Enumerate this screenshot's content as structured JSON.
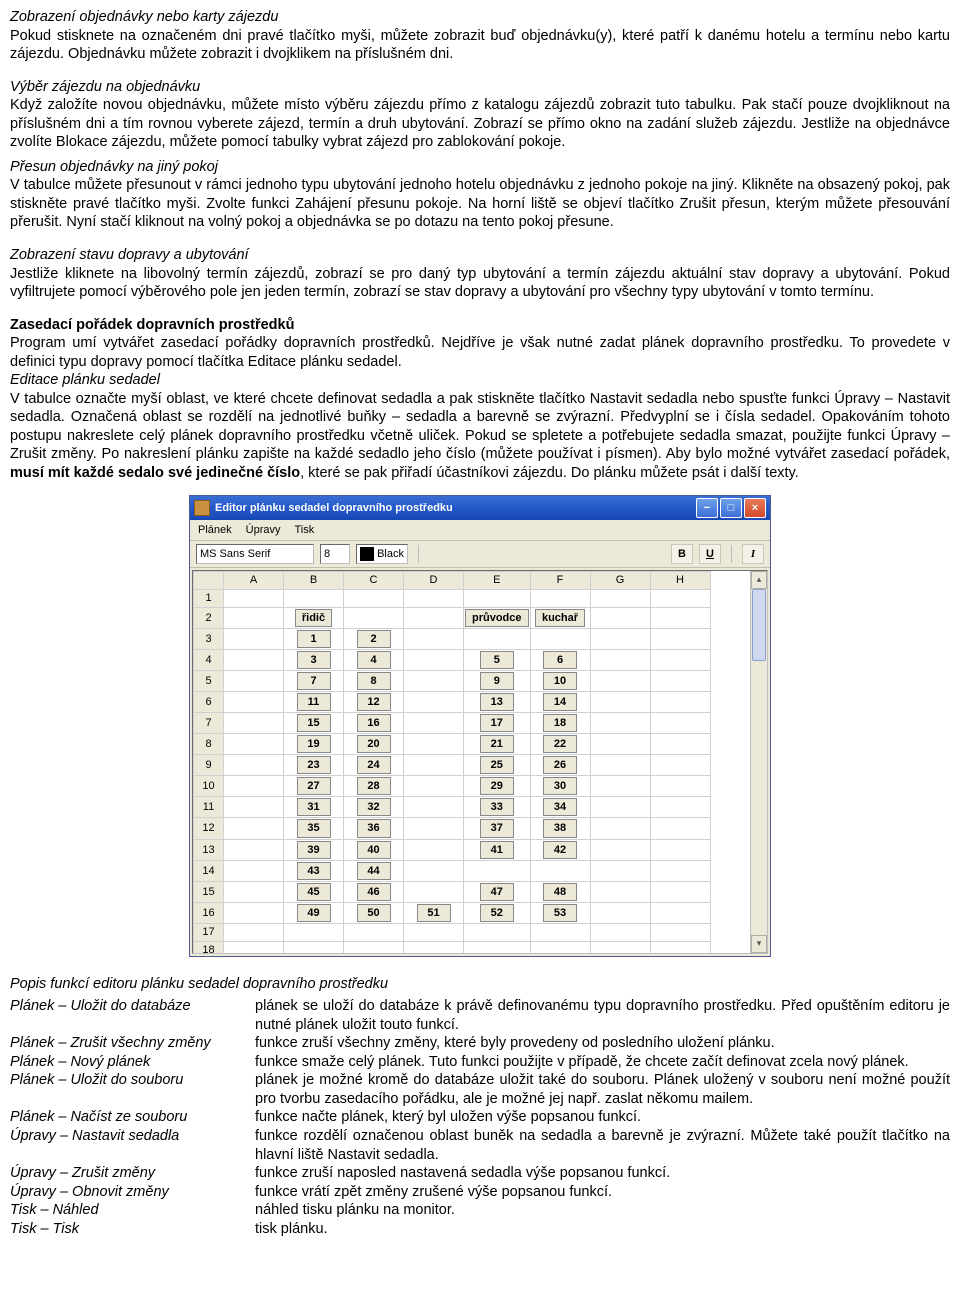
{
  "s1": {
    "h": "Zobrazení objednávky nebo karty zájezdu",
    "p": "Pokud stisknete na označeném dni pravé tlačítko myši, můžete zobrazit buď objednávku(y), které patří k danému hotelu a termínu nebo kartu zájezdu. Objednávku můžete zobrazit i dvojklikem na příslušném dni."
  },
  "s2": {
    "h": "Výběr zájezdu na objednávku",
    "p": "Když založíte novou objednávku, můžete místo výběru zájezdu přímo z katalogu zájezdů zobrazit tuto tabulku. Pak stačí pouze dvojkliknout na příslušném dni a tím rovnou vyberete zájezd, termín a druh ubytování. Zobrazí se přímo okno na zadání služeb zájezdu. Jestliže na objednávce zvolíte Blokace zájezdu, můžete pomocí tabulky vybrat zájezd pro zablokování pokoje."
  },
  "s3": {
    "h": "Přesun objednávky na jiný pokoj",
    "p": "V tabulce můžete přesunout v rámci jednoho typu ubytování jednoho hotelu objednávku z jednoho pokoje na jiný. Klikněte na obsazený pokoj, pak stiskněte pravé tlačítko myši. Zvolte funkci Zahájení přesunu pokoje. Na horní liště se objeví tlačítko Zrušit přesun, kterým můžete přesouvání přerušit. Nyní stačí kliknout na volný pokoj a objednávka se po dotazu na tento pokoj přesune."
  },
  "s4": {
    "h": "Zobrazení stavu dopravy a ubytování",
    "p": "Jestliže kliknete na libovolný termín zájezdů, zobrazí se pro daný typ ubytování a termín zájezdu aktuální stav dopravy a ubytování. Pokud vyfiltrujete pomocí výběrového pole jen jeden termín, zobrazí se stav dopravy a ubytování pro všechny typy ubytování v tomto termínu."
  },
  "s5": {
    "h": "Zasedací pořádek dopravních prostředků",
    "p": "Program umí vytvářet zasedací pořádky dopravních prostředků. Nejdříve je však nutné zadat plánek dopravního prostředku. To provedete v definici typu dopravy pomocí tlačítka Editace plánku sedadel."
  },
  "s6": {
    "h": "Editace plánku sedadel",
    "p1": "V tabulce označte myší oblast, ve které chcete definovat sedadla a pak stiskněte tlačítko Nastavit sedadla nebo spusťte funkci Úpravy – Nastavit sedadla. Označená oblast se rozdělí na jednotlivé buňky – sedadla a barevně se zvýrazní. Předvyplní se i čísla sedadel. Opakováním tohoto postupu nakreslete celý plánek dopravního prostředku včetně uliček. Pokud se spletete a potřebujete sedadla smazat, použijte funkci Úpravy – Zrušit změny. Po nakreslení plánku zapište na každé sedadlo jeho číslo (můžete používat i písmen). Aby bylo možné vytvářet zasedací pořádek, ",
    "p1b": "musí mít každé sedalo své jedinečné číslo",
    "p1c": ", které se pak přiřadí účastníkovi zájezdu. Do plánku můžete psát i další texty."
  },
  "editor": {
    "title": "Editor plánku sedadel dopravního prostředku",
    "menu": {
      "m1": "Plánek",
      "m2": "Úpravy",
      "m3": "Tisk"
    },
    "toolbar": {
      "font": "MS Sans Serif",
      "size": "8",
      "color": "Black",
      "b": "B",
      "u": "U",
      "i": "I"
    },
    "cols": [
      "A",
      "B",
      "C",
      "D",
      "E",
      "F",
      "G",
      "H"
    ],
    "rows": [
      "1",
      "2",
      "3",
      "4",
      "5",
      "6",
      "7",
      "8",
      "9",
      "10",
      "11",
      "12",
      "13",
      "14",
      "15",
      "16",
      "17",
      "18"
    ],
    "labels": {
      "ridic": "řidič",
      "pruvodce": "průvodce",
      "kuchar": "kuchař"
    },
    "grid": {
      "r3": {
        "B": "1",
        "C": "2"
      },
      "r4": {
        "B": "3",
        "C": "4",
        "E": "5",
        "F": "6"
      },
      "r5": {
        "B": "7",
        "C": "8",
        "E": "9",
        "F": "10"
      },
      "r6": {
        "B": "11",
        "C": "12",
        "E": "13",
        "F": "14"
      },
      "r7": {
        "B": "15",
        "C": "16",
        "E": "17",
        "F": "18"
      },
      "r8": {
        "B": "19",
        "C": "20",
        "E": "21",
        "F": "22"
      },
      "r9": {
        "B": "23",
        "C": "24",
        "E": "25",
        "F": "26"
      },
      "r10": {
        "B": "27",
        "C": "28",
        "E": "29",
        "F": "30"
      },
      "r11": {
        "B": "31",
        "C": "32",
        "E": "33",
        "F": "34"
      },
      "r12": {
        "B": "35",
        "C": "36",
        "E": "37",
        "F": "38"
      },
      "r13": {
        "B": "39",
        "C": "40",
        "E": "41",
        "F": "42"
      },
      "r14": {
        "B": "43",
        "C": "44"
      },
      "r15": {
        "B": "45",
        "C": "46",
        "E": "47",
        "F": "48"
      },
      "r16": {
        "B": "49",
        "C": "50",
        "D": "51",
        "E": "52",
        "F": "53"
      }
    }
  },
  "funcs": {
    "h": "Popis funkcí editoru plánku sedadel dopravního prostředku",
    "items": [
      {
        "l": "Plánek – Uložit do databáze",
        "d": "plánek se uloží do databáze k právě definovanému typu dopravního prostředku. Před opuštěním editoru je nutné plánek uložit touto funkcí."
      },
      {
        "l": "Plánek – Zrušit všechny změny",
        "d": "funkce zruší všechny změny, které byly provedeny od posledního uložení plánku."
      },
      {
        "l": "Plánek – Nový plánek",
        "d": "funkce smaže celý plánek. Tuto funkci použijte v případě, že chcete začít definovat zcela nový plánek."
      },
      {
        "l": "Plánek – Uložit do souboru",
        "d": "plánek je možné kromě do databáze uložit také do souboru. Plánek uložený v souboru není možné použít pro tvorbu zasedacího pořádku, ale je možné jej např. zaslat někomu mailem."
      },
      {
        "l": "Plánek – Načíst ze souboru",
        "d": "funkce načte plánek, který byl uložen výše popsanou funkcí."
      },
      {
        "l": "Úpravy – Nastavit sedadla",
        "d": "funkce rozdělí označenou oblast buněk na sedadla a barevně je zvýrazní. Můžete také použít tlačítko na hlavní liště Nastavit sedadla."
      },
      {
        "l": "Úpravy – Zrušit změny",
        "d": "funkce zruší naposled nastavená sedadla výše popsanou funkcí."
      },
      {
        "l": "Úpravy – Obnovit změny",
        "d": "funkce vrátí zpět změny zrušené výše popsanou funkcí."
      },
      {
        "l": "Tisk – Náhled",
        "d": "náhled tisku plánku na monitor."
      },
      {
        "l": "Tisk – Tisk",
        "d": "tisk plánku."
      }
    ]
  }
}
